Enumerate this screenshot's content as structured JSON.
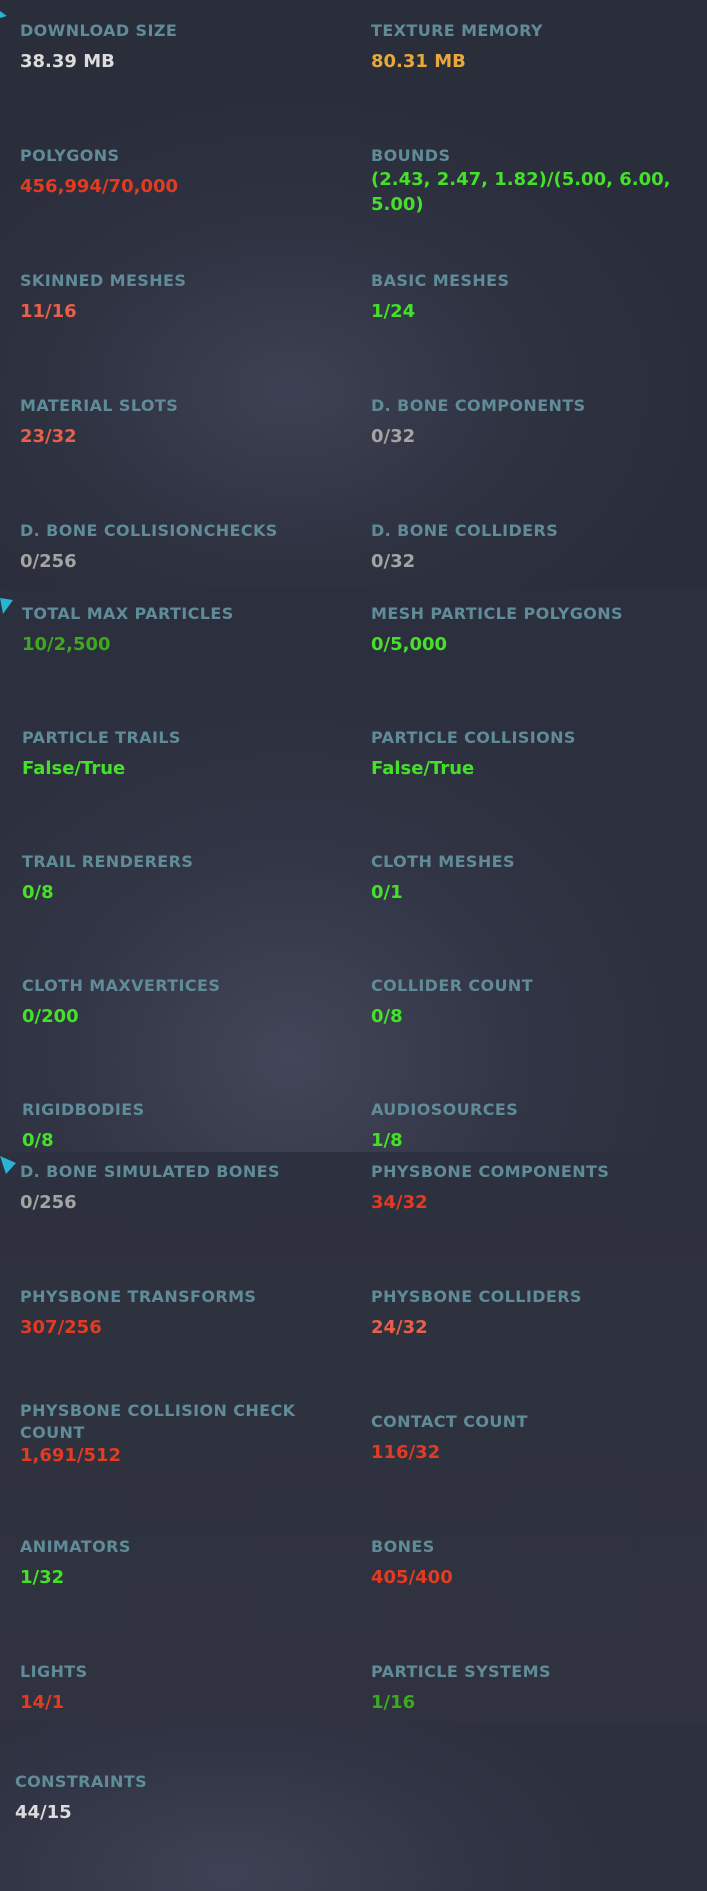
{
  "colors": {
    "label": "#5f8c98",
    "white": "#dcdcdc",
    "gray": "#a4a4a4",
    "orange": "#e8a93a",
    "red": "#e33b22",
    "salmon": "#e8604a",
    "green": "#45e12a",
    "dark_green": "#3ea81e",
    "marker": "#29b3d5"
  },
  "stats": {
    "download_size": {
      "label": "DOWNLOAD SIZE",
      "value": "38.39 MB"
    },
    "texture_memory": {
      "label": "TEXTURE MEMORY",
      "value": "80.31 MB"
    },
    "polygons": {
      "label": "POLYGONS",
      "value": "456,994/70,000"
    },
    "bounds": {
      "label": "BOUNDS",
      "value": "(2.43, 2.47, 1.82)/(5.00, 6.00, 5.00)"
    },
    "skinned_meshes": {
      "label": "SKINNED MESHES",
      "value": "11/16"
    },
    "basic_meshes": {
      "label": "BASIC MESHES",
      "value": "1/24"
    },
    "material_slots": {
      "label": "MATERIAL SLOTS",
      "value": "23/32"
    },
    "d_bone_components": {
      "label": "D. BONE COMPONENTS",
      "value": "0/32"
    },
    "d_bone_collisionchecks": {
      "label": "D. BONE COLLISIONCHECKS",
      "value": "0/256"
    },
    "d_bone_colliders": {
      "label": "D. BONE COLLIDERS",
      "value": "0/32"
    },
    "total_max_particles": {
      "label": "TOTAL MAX PARTICLES",
      "value": "10/2,500"
    },
    "mesh_particle_polygons": {
      "label": "MESH PARTICLE POLYGONS",
      "value": "0/5,000"
    },
    "particle_trails": {
      "label": "PARTICLE TRAILS",
      "value": "False/True"
    },
    "particle_collisions": {
      "label": "PARTICLE COLLISIONS",
      "value": "False/True"
    },
    "trail_renderers": {
      "label": "TRAIL RENDERERS",
      "value": "0/8"
    },
    "cloth_meshes": {
      "label": "CLOTH MESHES",
      "value": "0/1"
    },
    "cloth_maxvertices": {
      "label": "CLOTH MAXVERTICES",
      "value": "0/200"
    },
    "collider_count": {
      "label": "COLLIDER COUNT",
      "value": "0/8"
    },
    "rigidbodies": {
      "label": "RIGIDBODIES",
      "value": "0/8"
    },
    "audiosources": {
      "label": "AUDIOSOURCES",
      "value": "1/8"
    },
    "d_bone_simulated_bones": {
      "label": "D. BONE SIMULATED BONES",
      "value": "0/256"
    },
    "physbone_components": {
      "label": "PHYSBONE COMPONENTS",
      "value": "34/32"
    },
    "physbone_transforms": {
      "label": "PHYSBONE TRANSFORMS",
      "value": "307/256"
    },
    "physbone_colliders": {
      "label": "PHYSBONE COLLIDERS",
      "value": "24/32"
    },
    "physbone_collision_check_count": {
      "label": "PHYSBONE COLLISION CHECK COUNT",
      "value": "1,691/512"
    },
    "contact_count": {
      "label": "CONTACT COUNT",
      "value": "116/32"
    },
    "animators": {
      "label": "ANIMATORS",
      "value": "1/32"
    },
    "bones": {
      "label": "BONES",
      "value": "405/400"
    },
    "lights": {
      "label": "LIGHTS",
      "value": "14/1"
    },
    "particle_systems": {
      "label": "PARTICLE SYSTEMS",
      "value": "1/16"
    },
    "constraints": {
      "label": "CONSTRAINTS",
      "value": "44/15"
    }
  }
}
